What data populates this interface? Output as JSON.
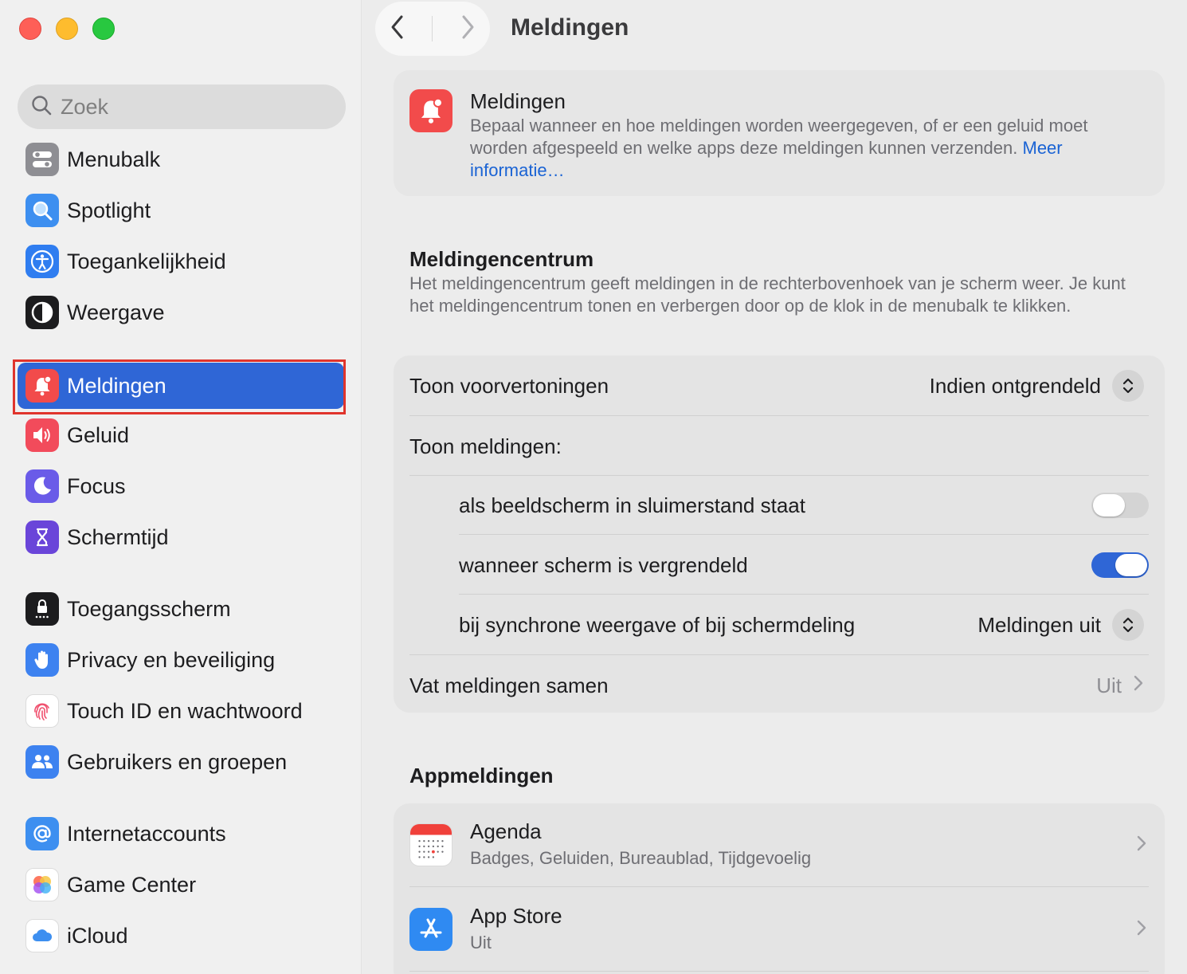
{
  "window": {
    "title": "Meldingen"
  },
  "search": {
    "placeholder": "Zoek"
  },
  "sidebar": {
    "items": [
      {
        "label": "Menubalk"
      },
      {
        "label": "Spotlight"
      },
      {
        "label": "Toegankelijkheid"
      },
      {
        "label": "Weergave"
      },
      {
        "label": "Meldingen",
        "selected": true
      },
      {
        "label": "Geluid"
      },
      {
        "label": "Focus"
      },
      {
        "label": "Schermtijd"
      },
      {
        "label": "Toegangsscherm"
      },
      {
        "label": "Privacy en beveiliging"
      },
      {
        "label": "Touch ID en wachtwoord"
      },
      {
        "label": "Gebruikers en groepen"
      },
      {
        "label": "Internetaccounts"
      },
      {
        "label": "Game Center"
      },
      {
        "label": "iCloud"
      }
    ]
  },
  "intro": {
    "title": "Meldingen",
    "description": "Bepaal wanneer en hoe meldingen worden weergegeven, of er een geluid moet worden afgespeeld en welke apps deze meldingen kunnen verzenden.",
    "link": "Meer informatie…"
  },
  "notification_center": {
    "title": "Meldingencentrum",
    "description": "Het meldingencentrum geeft meldingen in de rechterbovenhoek van je scherm weer. Je kunt het meldingencentrum tonen en verbergen door op de klok in de menubalk te klikken.",
    "show_previews_label": "Toon voorvertoningen",
    "show_previews_value": "Indien ontgrendeld",
    "show_notifications_label": "Toon meldingen:",
    "sleep_label": "als beeldscherm in sluimerstand staat",
    "sleep_enabled": false,
    "locked_label": "wanneer scherm is vergrendeld",
    "locked_enabled": true,
    "mirroring_label": "bij synchrone weergave of bij schermdeling",
    "mirroring_value": "Meldingen uit",
    "summary_label": "Vat meldingen samen",
    "summary_value": "Uit"
  },
  "app_notifications": {
    "title": "Appmeldingen",
    "apps": [
      {
        "name": "Agenda",
        "detail": "Badges, Geluiden, Bureaublad, Tijdgevoelig"
      },
      {
        "name": "App Store",
        "detail": "Uit"
      }
    ]
  },
  "colors": {
    "accent": "#2f66d6",
    "highlight_border": "#e0342c",
    "link": "#1a63d4"
  }
}
